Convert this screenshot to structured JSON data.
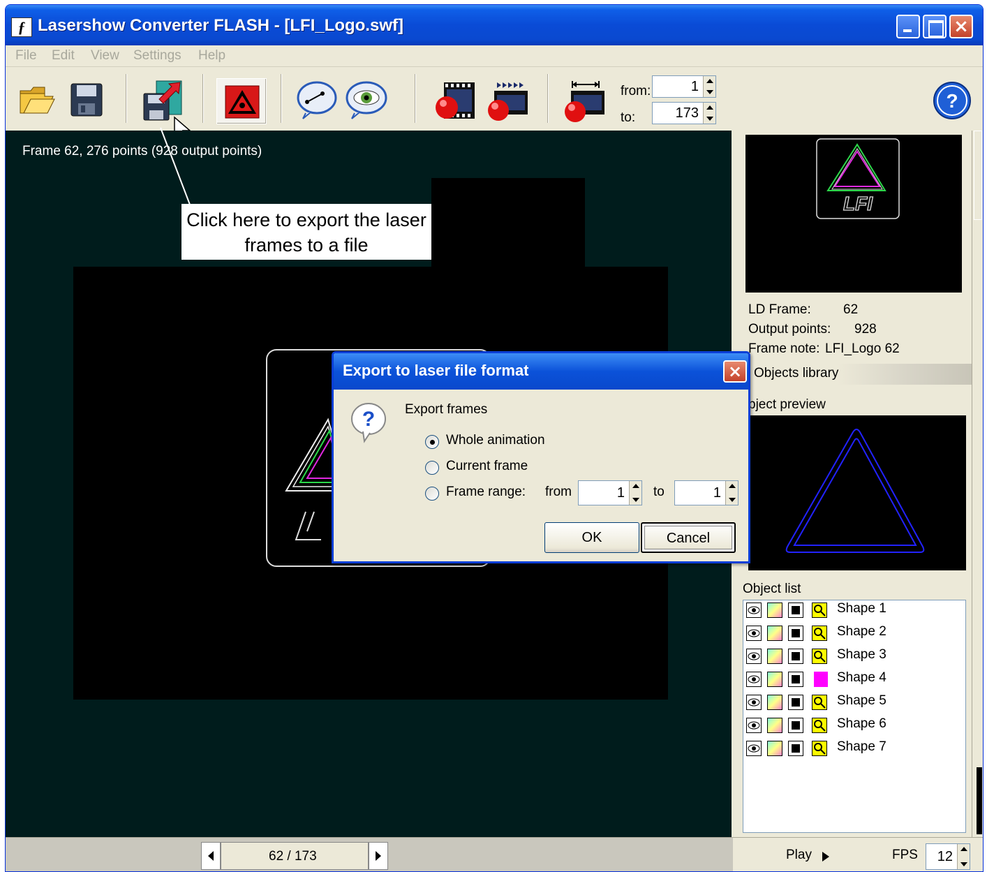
{
  "window": {
    "title": "Lasershow Converter FLASH - [LFI_Logo.swf]",
    "app_icon_glyph": "ƒ"
  },
  "menu": {
    "items": [
      "File",
      "Edit",
      "View",
      "Settings",
      "Help"
    ]
  },
  "toolbar": {
    "icons": [
      "open-folder-icon",
      "save-disk-icon",
      "export-laser-file-icon",
      "laser-warning-icon",
      "path-edit-icon",
      "preview-eye-icon",
      "record-frame-icon",
      "record-animation-icon",
      "frame-range-icon",
      "help-icon"
    ],
    "from_label": "from:",
    "from_value": "1",
    "to_label": "to:",
    "to_value": "173"
  },
  "canvas": {
    "frame_info": "Frame 62,   276 points   (928 output points)",
    "callout": "Click here to export the laser frames to a file"
  },
  "right_panel": {
    "ld_frame_label": "LD Frame:",
    "ld_frame_value": "62",
    "output_points_label": "Output points:",
    "output_points_value": "928",
    "frame_note_label": "Frame note:",
    "frame_note_value": "LFI_Logo 62",
    "library_header": "Objects library",
    "object_preview_label": "bject preview",
    "object_list_label": "Object list",
    "objects": [
      {
        "name": "Shape 1",
        "key_icon": true
      },
      {
        "name": "Shape 2",
        "key_icon": true
      },
      {
        "name": "Shape 3",
        "key_icon": true
      },
      {
        "name": "Shape 4",
        "key_icon": false,
        "color": "#ff00ff"
      },
      {
        "name": "Shape 5",
        "key_icon": true
      },
      {
        "name": "Shape 6",
        "key_icon": true
      },
      {
        "name": "Shape 7",
        "key_icon": true
      }
    ],
    "logo_text": "LFI"
  },
  "status": {
    "frame_position": "62 / 173",
    "play_label": "Play",
    "fps_label": "FPS",
    "fps_value": "12"
  },
  "dialog": {
    "title": "Export to laser file format",
    "heading": "Export frames",
    "options": [
      "Whole animation",
      "Current frame",
      "Frame range:"
    ],
    "selected_option": "Whole animation",
    "from_label": "from",
    "from_value": "1",
    "to_label": "to",
    "to_value": "1",
    "ok_label": "OK",
    "cancel_label": "Cancel"
  },
  "colors": {
    "title_blue": "#0a4bd6",
    "canvas_bg": "#001c1c",
    "shape4_swatch": "#ff00ff"
  }
}
